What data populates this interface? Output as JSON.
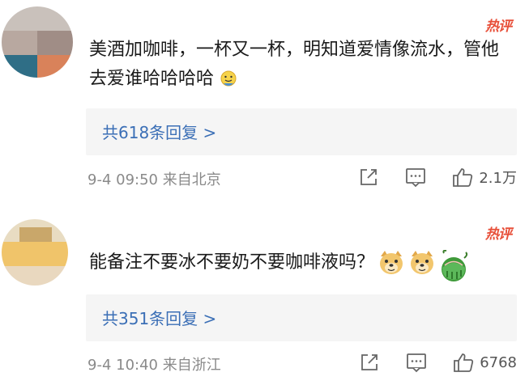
{
  "comments": [
    {
      "hot_label": "热评",
      "text": "美酒加咖啡，一杯又一杯，明知道爱情像流水，管他去爱谁哈哈哈哈",
      "emoji": [
        "smile-emoji"
      ],
      "replies": "共618条回复 >",
      "time": "9-4 09:50 来自北京",
      "likes": "2.1万"
    },
    {
      "hot_label": "热评",
      "text": "能备注不要冰不要奶不要咖啡液吗？",
      "emoji": [
        "doge-emoji",
        "doge-emoji",
        "watermelon-emoji"
      ],
      "replies": "共351条回复 >",
      "time": "9-4 10:40 来自浙江",
      "likes": "6768"
    }
  ],
  "colors": {
    "hot": "#e8503a",
    "link": "#3b6fb6",
    "meta": "#8a8a8a",
    "reply_bg": "#f5f5f5"
  }
}
